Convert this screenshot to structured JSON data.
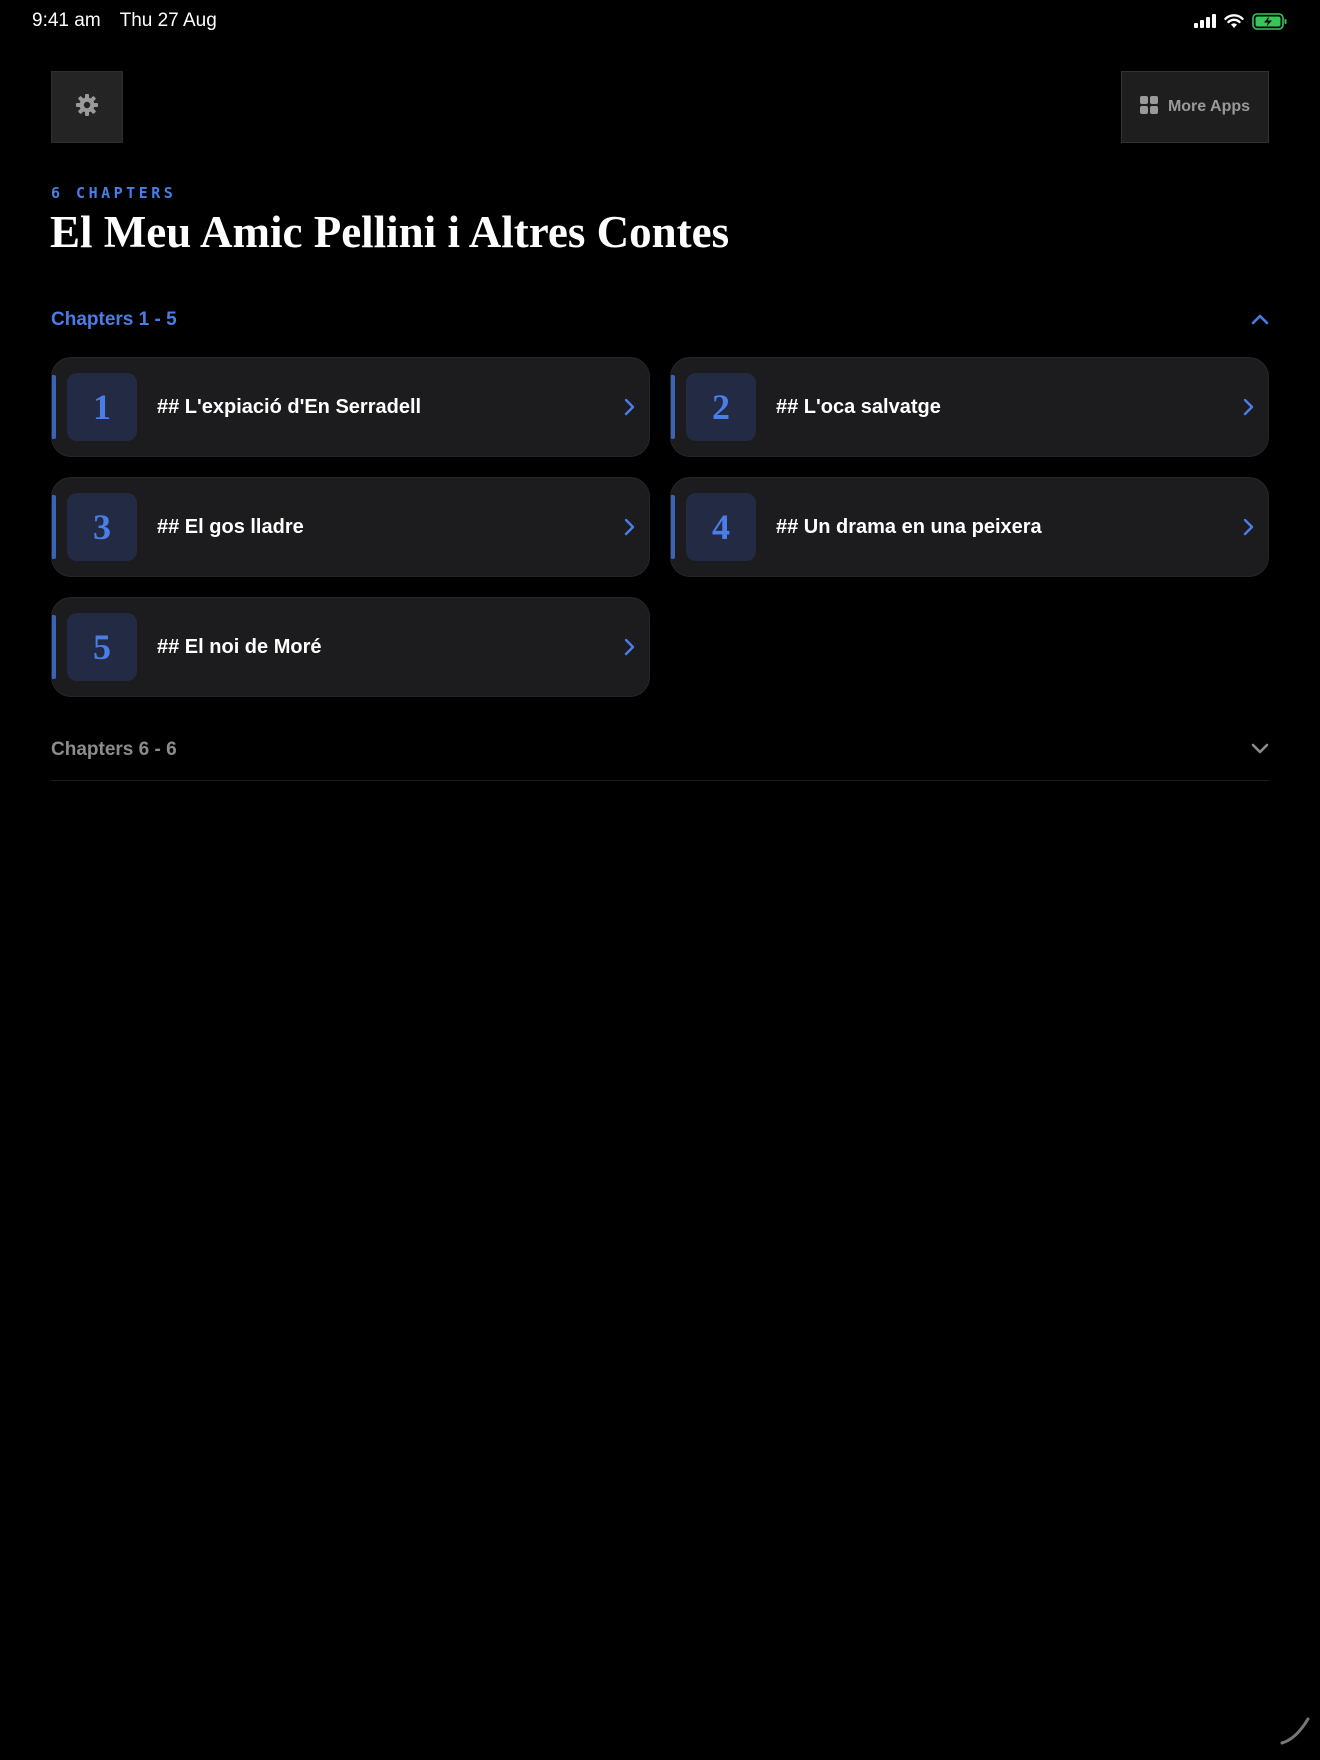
{
  "status_bar": {
    "time": "9:41 am",
    "date": "Thu 27 Aug"
  },
  "toolbar": {
    "more_apps_label": "More Apps"
  },
  "book": {
    "chapter_count": "6 CHAPTERS",
    "title": "El Meu Amic Pellini i Altres Contes"
  },
  "sections": [
    {
      "label": "Chapters 1 - 5",
      "expanded": true,
      "chapters": [
        {
          "number": "1",
          "title": "## L'expiació d'En Serradell"
        },
        {
          "number": "2",
          "title": "## L'oca salvatge"
        },
        {
          "number": "3",
          "title": "## El gos lladre"
        },
        {
          "number": "4",
          "title": "## Un drama en una peixera"
        },
        {
          "number": "5",
          "title": "## El noi de Moré"
        }
      ]
    },
    {
      "label": "Chapters 6 - 6",
      "expanded": false
    }
  ],
  "colors": {
    "accent": "#4a7de6",
    "card": "#1c1c1e",
    "battery": "#35c759"
  }
}
